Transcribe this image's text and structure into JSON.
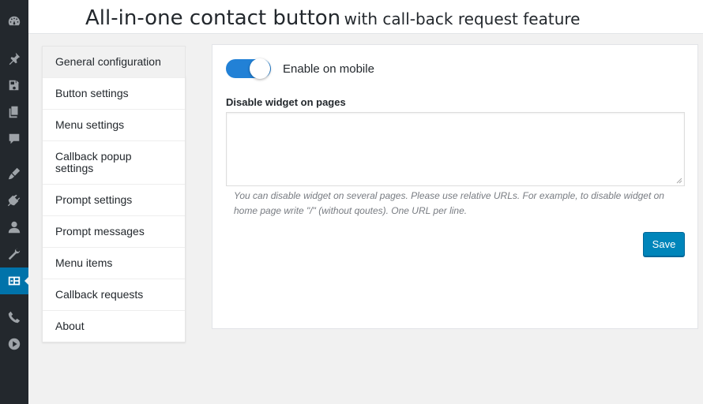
{
  "header": {
    "title": "All-in-one contact button",
    "subtitle": "with call-back request feature"
  },
  "sidebar_icons": [
    "dashboard-icon",
    "pin-icon",
    "media-icon",
    "pages-icon",
    "comments-icon",
    "appearance-icon",
    "plugins-icon",
    "users-icon",
    "tools-icon",
    "contact-button-icon",
    "phone-icon",
    "play-icon"
  ],
  "nav": {
    "items": [
      {
        "label": "General configuration",
        "active": true
      },
      {
        "label": "Button settings"
      },
      {
        "label": "Menu settings"
      },
      {
        "label": "Callback popup settings"
      },
      {
        "label": "Prompt settings"
      },
      {
        "label": "Prompt messages"
      },
      {
        "label": "Menu items"
      },
      {
        "label": "Callback requests"
      },
      {
        "label": "About"
      }
    ]
  },
  "form": {
    "enable_mobile_label": "Enable on mobile",
    "enable_mobile_on": true,
    "disable_pages_label": "Disable widget on pages",
    "disable_pages_value": "",
    "help_text": "You can disable widget on several pages. Please use relative URLs. For example, to disable widget on home page write \"/\" (without qoutes). One URL per line.",
    "save_label": "Save"
  },
  "colors": {
    "accent": "#0085ba",
    "toggle_on": "#2281d6",
    "sidebar_bg": "#23282d",
    "active_menu": "#0073aa"
  }
}
